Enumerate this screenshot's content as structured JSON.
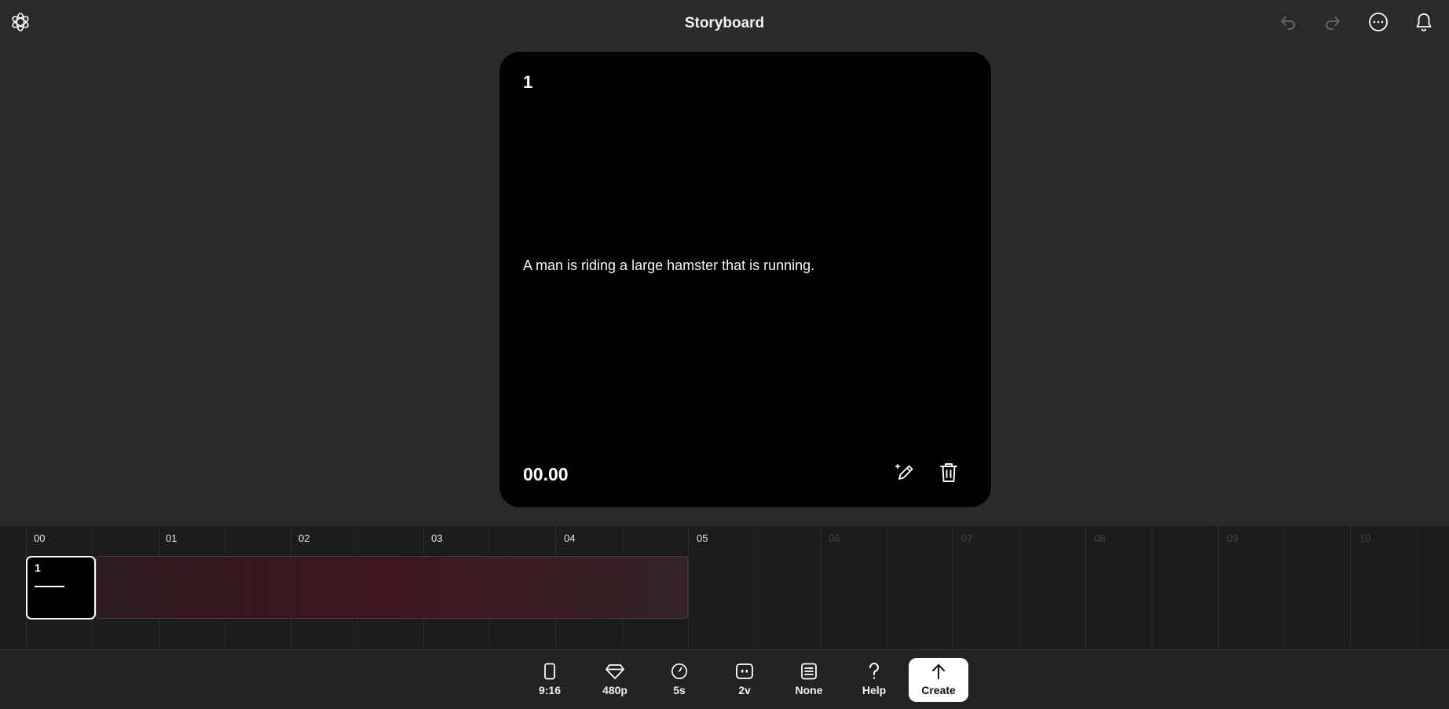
{
  "header": {
    "title": "Storyboard",
    "icons": [
      "openai-logo-icon",
      "undo-icon",
      "redo-icon",
      "more-options-icon",
      "notifications-bell-icon"
    ]
  },
  "card": {
    "number": "1",
    "prompt": "A man is riding a large hamster that is running.",
    "timestamp": "00.00",
    "icons": [
      "edit-pencil-icon",
      "delete-trash-icon"
    ]
  },
  "timeline": {
    "labels": [
      "00",
      "01",
      "02",
      "03",
      "04",
      "05",
      "06",
      "07",
      "08",
      "09",
      "10"
    ],
    "clip": {
      "number": "1"
    }
  },
  "toolbar": {
    "items": [
      {
        "icon": "aspect-ratio-icon",
        "label": "9:16"
      },
      {
        "icon": "diamond-quality-icon",
        "label": "480p"
      },
      {
        "icon": "clock-duration-icon",
        "label": "5s"
      },
      {
        "icon": "variations-icon",
        "label": "2v"
      },
      {
        "icon": "preset-icon",
        "label": "None"
      },
      {
        "icon": "help-icon",
        "label": "Help"
      },
      {
        "icon": "upload-arrow-icon",
        "label": "Create"
      }
    ]
  },
  "colors": {
    "background": "#2a2a2a",
    "card": "#000000",
    "timeline": "#1c1c1c",
    "clip_fill": "#3f151d",
    "create_button": "#ffffff"
  }
}
